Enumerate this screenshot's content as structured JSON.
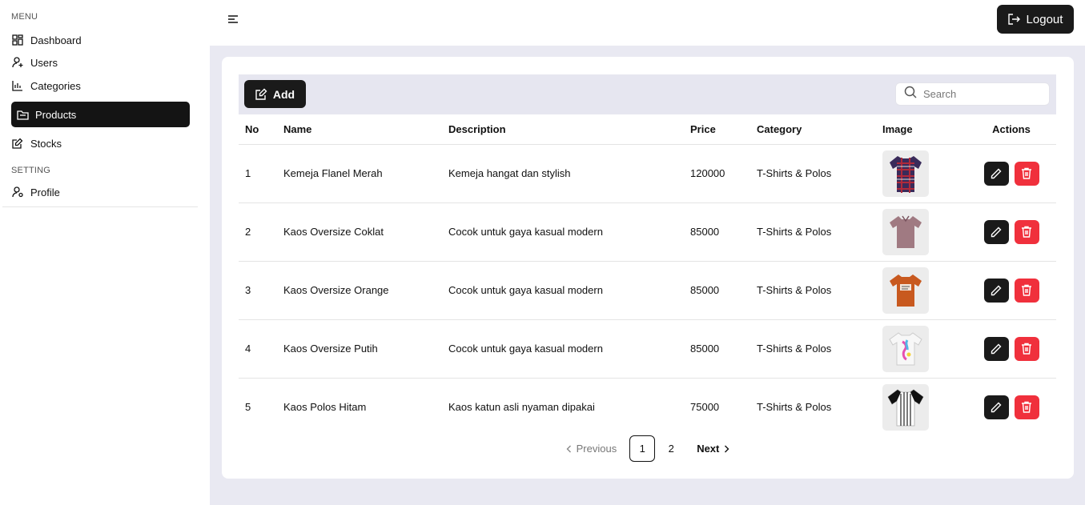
{
  "sidebar": {
    "menu_label": "MENU",
    "setting_label": "SETTING",
    "items": [
      {
        "label": "Dashboard",
        "icon": "dashboard-icon"
      },
      {
        "label": "Users",
        "icon": "user-plus-icon"
      },
      {
        "label": "Categories",
        "icon": "chart-icon"
      },
      {
        "label": "Products",
        "icon": "folder-icon",
        "active": true
      },
      {
        "label": "Stocks",
        "icon": "edit-icon"
      }
    ],
    "settings": [
      {
        "label": "Profile",
        "icon": "user-gear-icon"
      }
    ]
  },
  "header": {
    "logout_label": "Logout"
  },
  "toolbar": {
    "add_label": "Add",
    "search_placeholder": "Search"
  },
  "table": {
    "headers": [
      "No",
      "Name",
      "Description",
      "Price",
      "Category",
      "Image",
      "Actions"
    ],
    "rows": [
      {
        "no": "1",
        "name": "Kemeja Flanel Merah",
        "description": "Kemeja hangat dan stylish",
        "price": "120000",
        "category": "T-Shirts & Polos",
        "image": "flannel-shirt"
      },
      {
        "no": "2",
        "name": "Kaos Oversize Coklat",
        "description": "Cocok untuk gaya kasual modern",
        "price": "85000",
        "category": "T-Shirts & Polos",
        "image": "brown-polo"
      },
      {
        "no": "3",
        "name": "Kaos Oversize Orange",
        "description": "Cocok untuk gaya kasual modern",
        "price": "85000",
        "category": "T-Shirts & Polos",
        "image": "orange-tee"
      },
      {
        "no": "4",
        "name": "Kaos Oversize Putih",
        "description": "Cocok untuk gaya kasual modern",
        "price": "85000",
        "category": "T-Shirts & Polos",
        "image": "white-tee"
      },
      {
        "no": "5",
        "name": "Kaos Polos Hitam",
        "description": "Kaos katun asli nyaman dipakai",
        "price": "75000",
        "category": "T-Shirts & Polos",
        "image": "raglan-tee"
      }
    ]
  },
  "pagination": {
    "previous_label": "Previous",
    "next_label": "Next",
    "pages": [
      "1",
      "2"
    ],
    "current": "1"
  },
  "colors": {
    "accent": "#1a1a1a",
    "danger": "#f0303c",
    "content_bg": "#e9e9f2"
  }
}
